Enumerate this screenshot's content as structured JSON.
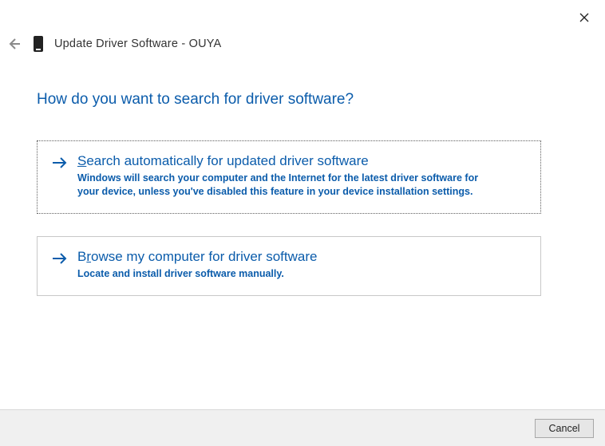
{
  "window": {
    "title": "Update Driver Software - OUYA"
  },
  "heading": "How do you want to search for driver software?",
  "options": [
    {
      "title_pre": "",
      "title_ak": "S",
      "title_post": "earch automatically for updated driver software",
      "desc": "Windows will search your computer and the Internet for the latest driver software for your device, unless you've disabled this feature in your device installation settings.",
      "selected": true
    },
    {
      "title_pre": "B",
      "title_ak": "r",
      "title_post": "owse my computer for driver software",
      "desc": "Locate and install driver software manually.",
      "selected": false
    }
  ],
  "buttons": {
    "cancel": "Cancel"
  }
}
